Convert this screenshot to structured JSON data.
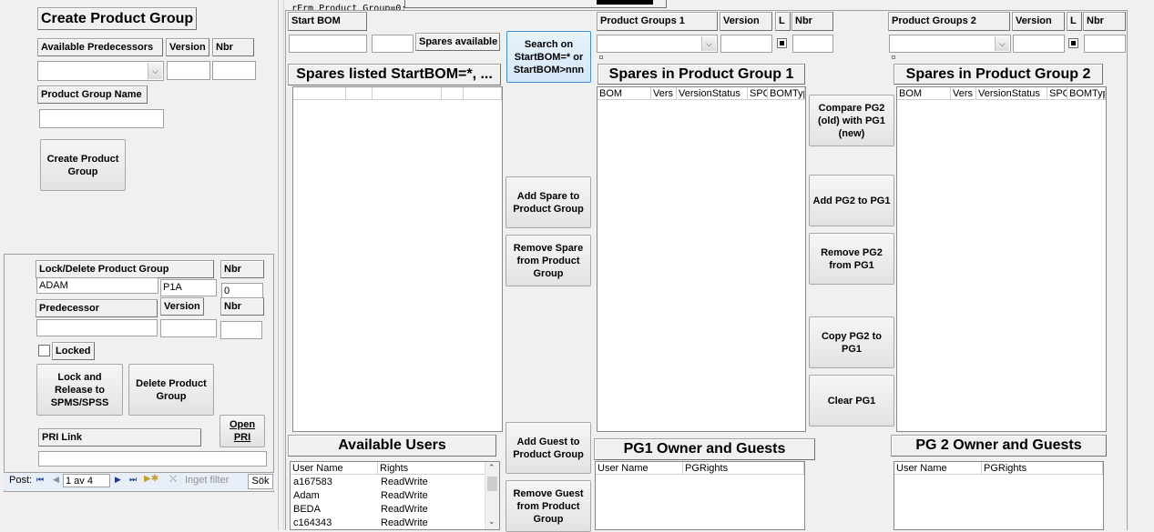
{
  "top_caption": "rFrm Product Group=0:",
  "create": {
    "title": "Create Product Group",
    "available_predecessors": "Available Predecessors",
    "version": "Version",
    "nbr": "Nbr",
    "product_group_name": "Product Group Name",
    "create_button": "Create Product Group"
  },
  "lockpanel": {
    "lock_delete_label": "Lock/Delete Product Group",
    "nbr_label": "Nbr",
    "group_value": "ADAM",
    "code_value": "P1A",
    "nbr_value": "0",
    "predecessor_label": "Predecessor",
    "version_label": "Version",
    "nbr2_label": "Nbr",
    "locked_label": "Locked",
    "lock_release_button": "Lock and Release to SPMS/SPSS",
    "delete_button": "Delete Product Group",
    "pri_link_label": "PRI Link",
    "open_pri_button": "Open PRI"
  },
  "navbar": {
    "post_label": "Post:",
    "record_text": "1 av 4",
    "filter_label": "Inget filter",
    "search_label": "Sök"
  },
  "startbom": {
    "label": "Start BOM",
    "spares_available": "Spares available",
    "search_button": "Search on StartBOM=* or StartBOM>nnn",
    "spares_listed_header": "Spares listed StartBOM=*, ..."
  },
  "middle_buttons": {
    "add_spare": "Add Spare to Product Group",
    "remove_spare": "Remove Spare from Product Group",
    "add_guest": "Add Guest to Product Group",
    "remove_guest": "Remove Guest from Product Group"
  },
  "users": {
    "header": "Available Users",
    "columns": [
      "User Name",
      "Rights"
    ],
    "rows": [
      {
        "name": "a167583",
        "rights": "ReadWrite"
      },
      {
        "name": "Adam",
        "rights": "ReadWrite"
      },
      {
        "name": "BEDA",
        "rights": "ReadWrite"
      },
      {
        "name": "c164343",
        "rights": "ReadWrite"
      }
    ]
  },
  "pg1": {
    "groups_label": "Product Groups 1",
    "version_label": "Version",
    "l_label": "L",
    "nbr_label": "Nbr",
    "spares_header": "Spares in Product Group 1",
    "columns": [
      "BOM",
      "Vers",
      "VersionStatus",
      "SPC",
      "BOMType"
    ],
    "owner_header": "PG1 Owner and Guests",
    "owner_columns": [
      "User Name",
      "PGRights"
    ]
  },
  "between_buttons": {
    "compare": "Compare PG2 (old) with PG1 (new)",
    "add_pg2": "Add PG2 to PG1",
    "remove_pg2": "Remove PG2 from PG1",
    "copy_pg2": "Copy PG2 to PG1",
    "clear_pg1": "Clear PG1"
  },
  "pg2": {
    "groups_label": "Product Groups 2",
    "version_label": "Version",
    "l_label": "L",
    "nbr_label": "Nbr",
    "spares_header": "Spares in Product Group 2",
    "columns": [
      "BOM",
      "Vers",
      "VersionStatus",
      "SPC",
      "BOMType"
    ],
    "owner_header": "PG 2 Owner and Guests",
    "owner_columns": [
      "User Name",
      "PGRights"
    ]
  }
}
